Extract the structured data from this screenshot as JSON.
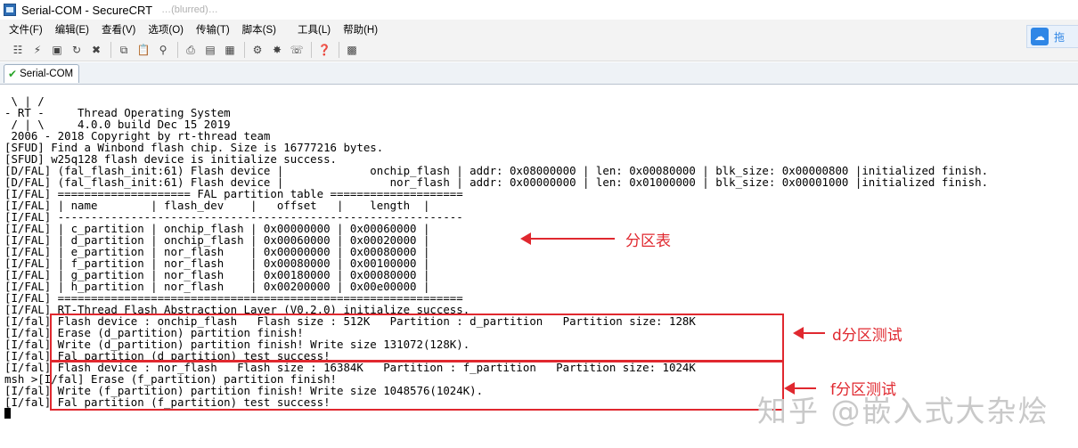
{
  "window": {
    "title": "Serial-COM - SecureCRT",
    "title_suffix": "…(blurred)…"
  },
  "menu": [
    "文件(F)",
    "编辑(E)",
    "查看(V)",
    "选项(O)",
    "传输(T)",
    "脚本(S)",
    "工具(L)",
    "帮助(H)"
  ],
  "toolbar": {
    "icons": [
      "connect-icon",
      "quick-connect-icon",
      "connect-tab-icon",
      "reconnect-icon",
      "disconnect-icon",
      "copy-icon",
      "paste-icon",
      "find-icon",
      "print-icon",
      "print-selection-icon",
      "printer-setup-icon",
      "session-options-icon",
      "global-options-icon",
      "keymap-icon",
      "help-icon",
      "about-icon"
    ]
  },
  "side_widget": {
    "text": "拖"
  },
  "tab": {
    "label": "Serial-COM"
  },
  "terminal": {
    "lines": [
      " \\ | /",
      "- RT -     Thread Operating System",
      " / | \\     4.0.0 build Dec 15 2019",
      " 2006 - 2018 Copyright by rt-thread team",
      "[SFUD] Find a Winbond flash chip. Size is 16777216 bytes.",
      "[SFUD] w25q128 flash device is initialize success.",
      "[D/FAL] (fal_flash_init:61) Flash device |             onchip_flash | addr: 0x08000000 | len: 0x00080000 | blk_size: 0x00000800 |initialized finish.",
      "[D/FAL] (fal_flash_init:61) Flash device |                nor_flash | addr: 0x00000000 | len: 0x01000000 | blk_size: 0x00001000 |initialized finish.",
      "[I/FAL] ==================== FAL partition table ====================",
      "[I/FAL] | name        | flash_dev    |   offset   |    length  |",
      "[I/FAL] -------------------------------------------------------------",
      "[I/FAL] | c_partition | onchip_flash | 0x00000000 | 0x00060000 |",
      "[I/FAL] | d_partition | onchip_flash | 0x00060000 | 0x00020000 |",
      "[I/FAL] | e_partition | nor_flash    | 0x00000000 | 0x00080000 |",
      "[I/FAL] | f_partition | nor_flash    | 0x00080000 | 0x00100000 |",
      "[I/FAL] | g_partition | nor_flash    | 0x00180000 | 0x00080000 |",
      "[I/FAL] | h_partition | nor_flash    | 0x00200000 | 0x00e00000 |",
      "[I/FAL] =============================================================",
      "[I/FAL] RT-Thread Flash Abstraction Layer (V0.2.0) initialize success.",
      "[I/fal] Flash device : onchip_flash   Flash size : 512K   Partition : d_partition   Partition size: 128K",
      "[I/fal] Erase (d_partition) partition finish!",
      "[I/fal] Write (d_partition) partition finish! Write size 131072(128K).",
      "[I/fal] Fal partition (d_partition) test success!",
      "[I/fal] Flash device : nor_flash   Flash size : 16384K   Partition : f_partition   Partition size: 1024K",
      "msh >[I/fal] Erase (f_partition) partition finish!",
      "[I/fal] Write (f_partition) partition finish! Write size 1048576(1024K).",
      "[I/fal] Fal partition (f_partition) test success!"
    ]
  },
  "annotations": {
    "partition_table": "分区表",
    "d_test": "d分区测试",
    "f_test": "f分区测试",
    "accent_color": "#e0282f"
  },
  "watermark": "知乎 @嵌入式大杂烩"
}
